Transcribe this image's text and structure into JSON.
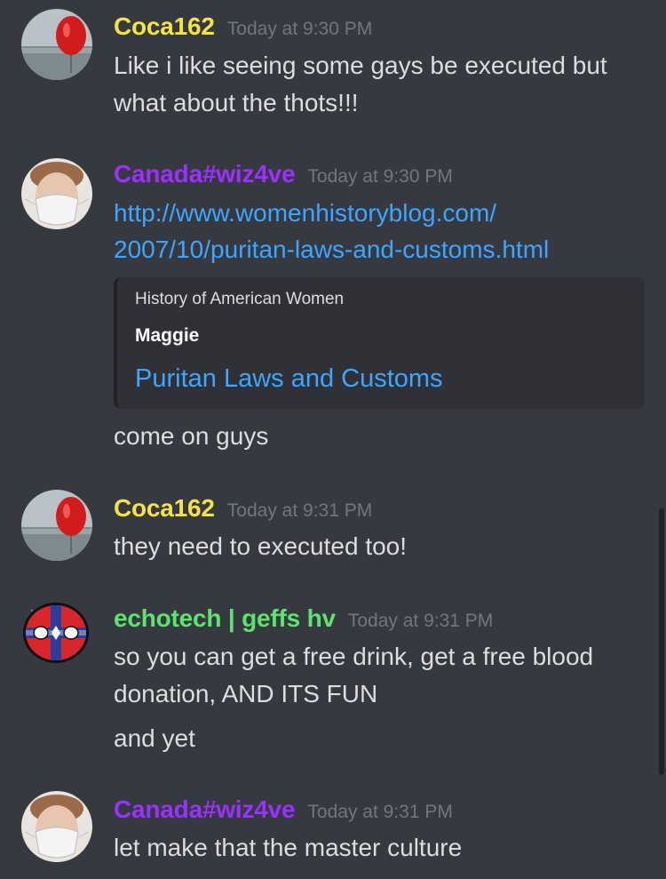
{
  "colors": {
    "coca_name": "#f3e442",
    "canada_name": "#9b30ff",
    "echotech_name": "#5ee36d",
    "link": "#3ea6ff",
    "background": "#36393f",
    "timestamp": "#72767d"
  },
  "messages": [
    {
      "username": "Coca162",
      "timestamp": "Today at 9:30 PM",
      "avatar": "red-balloon-beach-avatar",
      "lines": [
        "Like i like seeing some gays be executed but",
        "what about the thots!!!"
      ]
    },
    {
      "username": "Canada#wiz4ve",
      "timestamp": "Today at 9:30 PM",
      "avatar": "masked-face-avatar",
      "link_lines": [
        "http://www.womenhistoryblog.com/",
        "2007/10/puritan-laws-and-customs.html"
      ],
      "embed": {
        "provider": "History of American Women",
        "author": "Maggie",
        "title": "Puritan Laws and Customs"
      },
      "lines": [
        "come on guys"
      ]
    },
    {
      "username": "Coca162",
      "timestamp": "Today at 9:31 PM",
      "avatar": "red-balloon-beach-avatar",
      "lines": [
        "they need to executed too!"
      ]
    },
    {
      "username": "echotech | geffs hv",
      "timestamp": "Today at 9:31 PM",
      "avatar": "countryball-avatar",
      "lines": [
        "so you can get a free drink, get a free blood",
        "donation, AND ITS FUN",
        "and yet"
      ]
    },
    {
      "username": "Canada#wiz4ve",
      "timestamp": "Today at 9:31 PM",
      "avatar": "masked-face-avatar",
      "lines": [
        "let make that the master culture"
      ]
    }
  ]
}
